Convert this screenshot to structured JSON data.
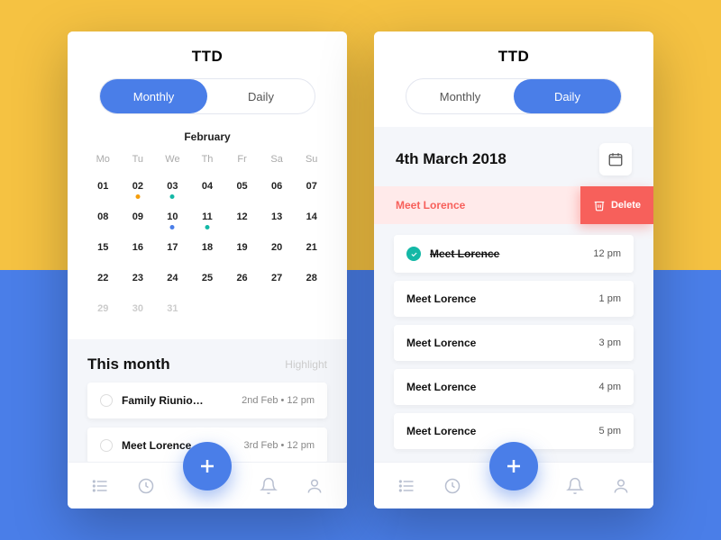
{
  "app": {
    "logo": "TTD"
  },
  "toggle": {
    "monthly": "Monthly",
    "daily": "Daily"
  },
  "monthly": {
    "month": "February",
    "weekdays": [
      "Mo",
      "Tu",
      "We",
      "Th",
      "Fr",
      "Sa",
      "Su"
    ],
    "days": [
      {
        "n": "01"
      },
      {
        "n": "02",
        "dot": "orange"
      },
      {
        "n": "03",
        "dot": "teal"
      },
      {
        "n": "04"
      },
      {
        "n": "05"
      },
      {
        "n": "06"
      },
      {
        "n": "07"
      },
      {
        "n": "08"
      },
      {
        "n": "09"
      },
      {
        "n": "10",
        "dot": "blue"
      },
      {
        "n": "11",
        "dot": "teal"
      },
      {
        "n": "12"
      },
      {
        "n": "13"
      },
      {
        "n": "14"
      },
      {
        "n": "15"
      },
      {
        "n": "16"
      },
      {
        "n": "17"
      },
      {
        "n": "18"
      },
      {
        "n": "19"
      },
      {
        "n": "20"
      },
      {
        "n": "21"
      },
      {
        "n": "22"
      },
      {
        "n": "23"
      },
      {
        "n": "24"
      },
      {
        "n": "25"
      },
      {
        "n": "26"
      },
      {
        "n": "27"
      },
      {
        "n": "28"
      },
      {
        "n": "29",
        "dim": true
      },
      {
        "n": "30",
        "dim": true
      },
      {
        "n": "31",
        "dim": true
      }
    ],
    "section_title": "This month",
    "section_sub": "Highlight",
    "events": [
      {
        "title": "Family Riunio…",
        "meta": "2nd Feb  •  12 pm"
      },
      {
        "title": "Meet Lorence",
        "meta": "3rd Feb  •  12 pm"
      }
    ]
  },
  "daily": {
    "date": "4th March 2018",
    "swipe": {
      "title": "Meet Lorence",
      "delete_label": "Delete"
    },
    "tasks": [
      {
        "title": "Meet Lorence",
        "time": "12 pm",
        "done": true
      },
      {
        "title": "Meet Lorence",
        "time": "1 pm"
      },
      {
        "title": "Meet Lorence",
        "time": "3 pm"
      },
      {
        "title": "Meet Lorence",
        "time": "4 pm"
      },
      {
        "title": "Meet Lorence",
        "time": "5 pm"
      }
    ]
  }
}
